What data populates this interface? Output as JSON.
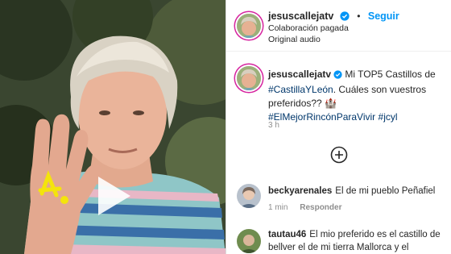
{
  "post": {
    "username": "jesuscallejatv",
    "follow_label": "Seguir",
    "dot": "•",
    "paid_partnership": "Colaboración pagada",
    "audio": "Original audio",
    "caption": {
      "text_1": "Mi TOP5 Castillos de",
      "hashtag_1": "#CastillaYLeón",
      "text_2": ". Cuáles son vuestros preferidos?? 🏰",
      "hashtag_2": "#ElMejorRincónParaVivir",
      "hashtag_3": "#jcyl"
    },
    "time": "3 h"
  },
  "comments": [
    {
      "username": "beckyarenales",
      "text": "El de mi pueblo Peñafiel",
      "time": "1 min",
      "reply_label": "Responder"
    },
    {
      "username": "tautau46",
      "text": "El mio preferido es el castillo de bellver el de mi tierra Mallorca y el"
    }
  ],
  "icons": {
    "verified": "verified-badge-icon",
    "play": "play-icon",
    "add": "add-circle-icon"
  },
  "colors": {
    "follow": "#0095f6",
    "hashtag": "#00376b",
    "muted": "#8e8e8e",
    "verified": "#0095f6",
    "highlighter": "#f4e40c"
  }
}
